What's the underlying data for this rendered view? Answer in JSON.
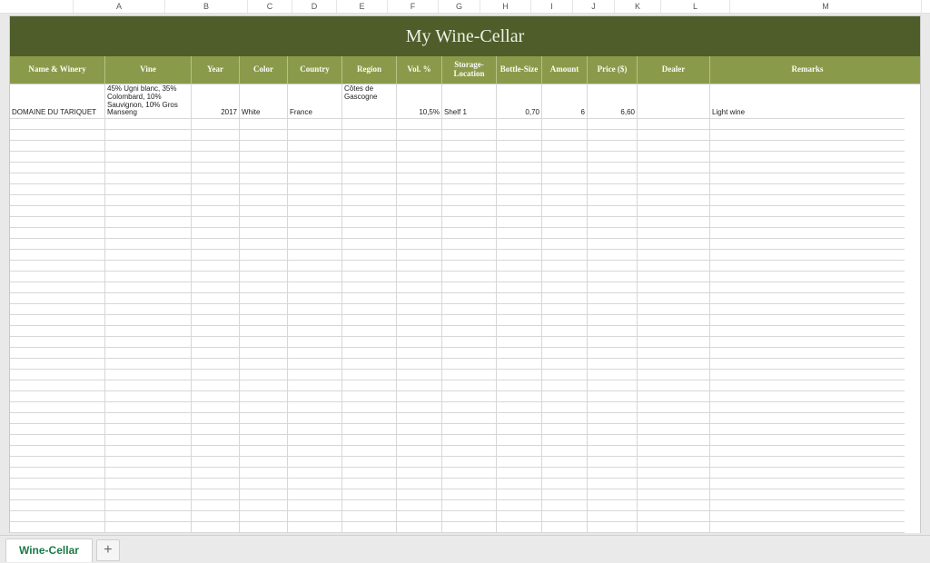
{
  "ruler_letters": [
    "A",
    "B",
    "C",
    "D",
    "E",
    "F",
    "G",
    "H",
    "I",
    "J",
    "K",
    "L",
    "M"
  ],
  "title": "My Wine-Cellar",
  "columns": [
    {
      "key": "name",
      "label": "Name & Winery",
      "cls": "c-A"
    },
    {
      "key": "vine",
      "label": "Vine",
      "cls": "c-B"
    },
    {
      "key": "year",
      "label": "Year",
      "cls": "c-C"
    },
    {
      "key": "color",
      "label": "Color",
      "cls": "c-D"
    },
    {
      "key": "country",
      "label": "Country",
      "cls": "c-E"
    },
    {
      "key": "region",
      "label": "Region",
      "cls": "c-F"
    },
    {
      "key": "vol",
      "label": "Vol. %",
      "cls": "c-G"
    },
    {
      "key": "storage",
      "label": "Storage-Location",
      "cls": "c-H"
    },
    {
      "key": "bottle",
      "label": "Bottle-Size",
      "cls": "c-I"
    },
    {
      "key": "amount",
      "label": "Amount",
      "cls": "c-J"
    },
    {
      "key": "price",
      "label": "Price ($)",
      "cls": "c-K"
    },
    {
      "key": "dealer",
      "label": "Dealer",
      "cls": "c-L"
    },
    {
      "key": "remarks",
      "label": "Remarks",
      "cls": "c-M"
    }
  ],
  "numeric_keys": [
    "year",
    "vol",
    "bottle",
    "amount",
    "price"
  ],
  "rows": [
    {
      "name": "DOMAINE DU TARIQUET",
      "vine": "45% Ugni blanc, 35% Colombard, 10% Sauvignon, 10% Gros Manseng",
      "year": "2017",
      "color": "White",
      "country": "France",
      "region": "Côtes de Gascogne",
      "vol": "10,5%",
      "storage": "Shelf 1",
      "bottle": "0,70",
      "amount": "6",
      "price": "6,60",
      "dealer": "",
      "remarks": "Light wine"
    }
  ],
  "empty_row_count": 38,
  "tabs": {
    "active": "Wine-Cellar",
    "add_symbol": "+"
  }
}
